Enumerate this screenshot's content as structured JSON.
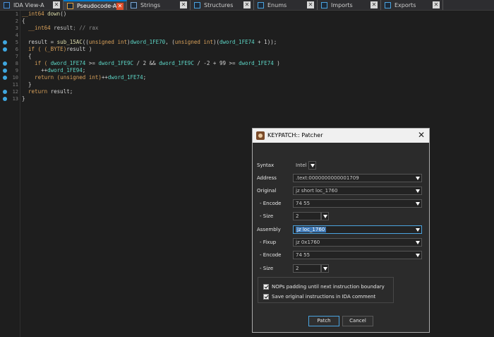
{
  "tabs": [
    {
      "label": "IDA View-A",
      "icon": "ida-view-icon",
      "active": false
    },
    {
      "label": "Pseudocode-A",
      "icon": "pseudocode-icon",
      "active": true
    },
    {
      "label": "Strings",
      "icon": "strings-icon",
      "active": false
    },
    {
      "label": "Structures",
      "icon": "structures-icon",
      "active": false
    },
    {
      "label": "Enums",
      "icon": "enums-icon",
      "active": false
    },
    {
      "label": "Imports",
      "icon": "imports-icon",
      "active": false
    },
    {
      "label": "Exports",
      "icon": "exports-icon",
      "active": false
    }
  ],
  "code": {
    "line_numbers": [
      "1",
      "2",
      "3",
      "4",
      "5",
      "6",
      "7",
      "8",
      "9",
      "10",
      "11",
      "12",
      "13"
    ],
    "breakpoint_lines": [
      "5",
      "6",
      "8",
      "9",
      "10",
      "12",
      "13"
    ],
    "lines": [
      [
        {
          "t": "__int64 ",
          "c": "kw"
        },
        {
          "t": "down",
          "c": "fn"
        },
        {
          "t": "()",
          "c": ""
        }
      ],
      [
        {
          "t": "{",
          "c": ""
        }
      ],
      [
        {
          "t": "  __int64 ",
          "c": "kw"
        },
        {
          "t": "result",
          "c": "var"
        },
        {
          "t": "; // rax",
          "c": "cm"
        }
      ],
      [],
      [
        {
          "t": "  result = ",
          "c": ""
        },
        {
          "t": "sub_15AC",
          "c": "fn"
        },
        {
          "t": "((",
          "c": ""
        },
        {
          "t": "unsigned int",
          "c": "kw"
        },
        {
          "t": ")",
          "c": ""
        },
        {
          "t": "dword_1FE70",
          "c": "gl"
        },
        {
          "t": ", (",
          "c": ""
        },
        {
          "t": "unsigned int",
          "c": "kw"
        },
        {
          "t": ")(",
          "c": ""
        },
        {
          "t": "dword_1FE74",
          "c": "gl"
        },
        {
          "t": " + 1));",
          "c": ""
        }
      ],
      [
        {
          "t": "  if ( ",
          "c": "kw"
        },
        {
          "t": "(_BYTE)",
          "c": "kw"
        },
        {
          "t": "result )",
          "c": ""
        }
      ],
      [
        {
          "t": "  {",
          "c": ""
        }
      ],
      [
        {
          "t": "    if ( ",
          "c": "kw"
        },
        {
          "t": "dword_1FE74",
          "c": "gl"
        },
        {
          "t": " >= ",
          "c": ""
        },
        {
          "t": "dword_1FE9C",
          "c": "gl"
        },
        {
          "t": " / 2 && ",
          "c": ""
        },
        {
          "t": "dword_1FE9C",
          "c": "gl"
        },
        {
          "t": " / -2 + 99 >= ",
          "c": ""
        },
        {
          "t": "dword_1FE74",
          "c": "gl"
        },
        {
          "t": " )",
          "c": ""
        }
      ],
      [
        {
          "t": "      ++",
          "c": ""
        },
        {
          "t": "dword_1FE94",
          "c": "gl"
        },
        {
          "t": ";",
          "c": ""
        }
      ],
      [
        {
          "t": "    return ",
          "c": "kw"
        },
        {
          "t": "(unsigned int)",
          "c": "kw"
        },
        {
          "t": "++",
          "c": ""
        },
        {
          "t": "dword_1FE74",
          "c": "gl"
        },
        {
          "t": ";",
          "c": ""
        }
      ],
      [
        {
          "t": "  }",
          "c": ""
        }
      ],
      [
        {
          "t": "  return ",
          "c": "kw"
        },
        {
          "t": "result;",
          "c": ""
        }
      ],
      [
        {
          "t": "}",
          "c": ""
        }
      ]
    ]
  },
  "dialog": {
    "title": "KEYPATCH:: Patcher",
    "syntax_label": "Syntax",
    "syntax_value": "Intel",
    "address_label": "Address",
    "address_value": ".text:0000000000001709",
    "original_label": "Original",
    "original_value": "jz short loc_1760",
    "encode_label": "- Encode",
    "original_encode": "74 55",
    "size_label": "- Size",
    "original_size": "2",
    "assembly_label": "Assembly",
    "assembly_value": "jz loc_1760",
    "fixup_label": "- Fixup",
    "fixup_value": "jz 0x1760",
    "assembly_encode": "74 55",
    "assembly_size": "2",
    "nop_label": "NOPs padding until next instruction boundary",
    "save_label": "Save original instructions in IDA comment",
    "patch_label": "Patch",
    "cancel_label": "Cancel"
  }
}
